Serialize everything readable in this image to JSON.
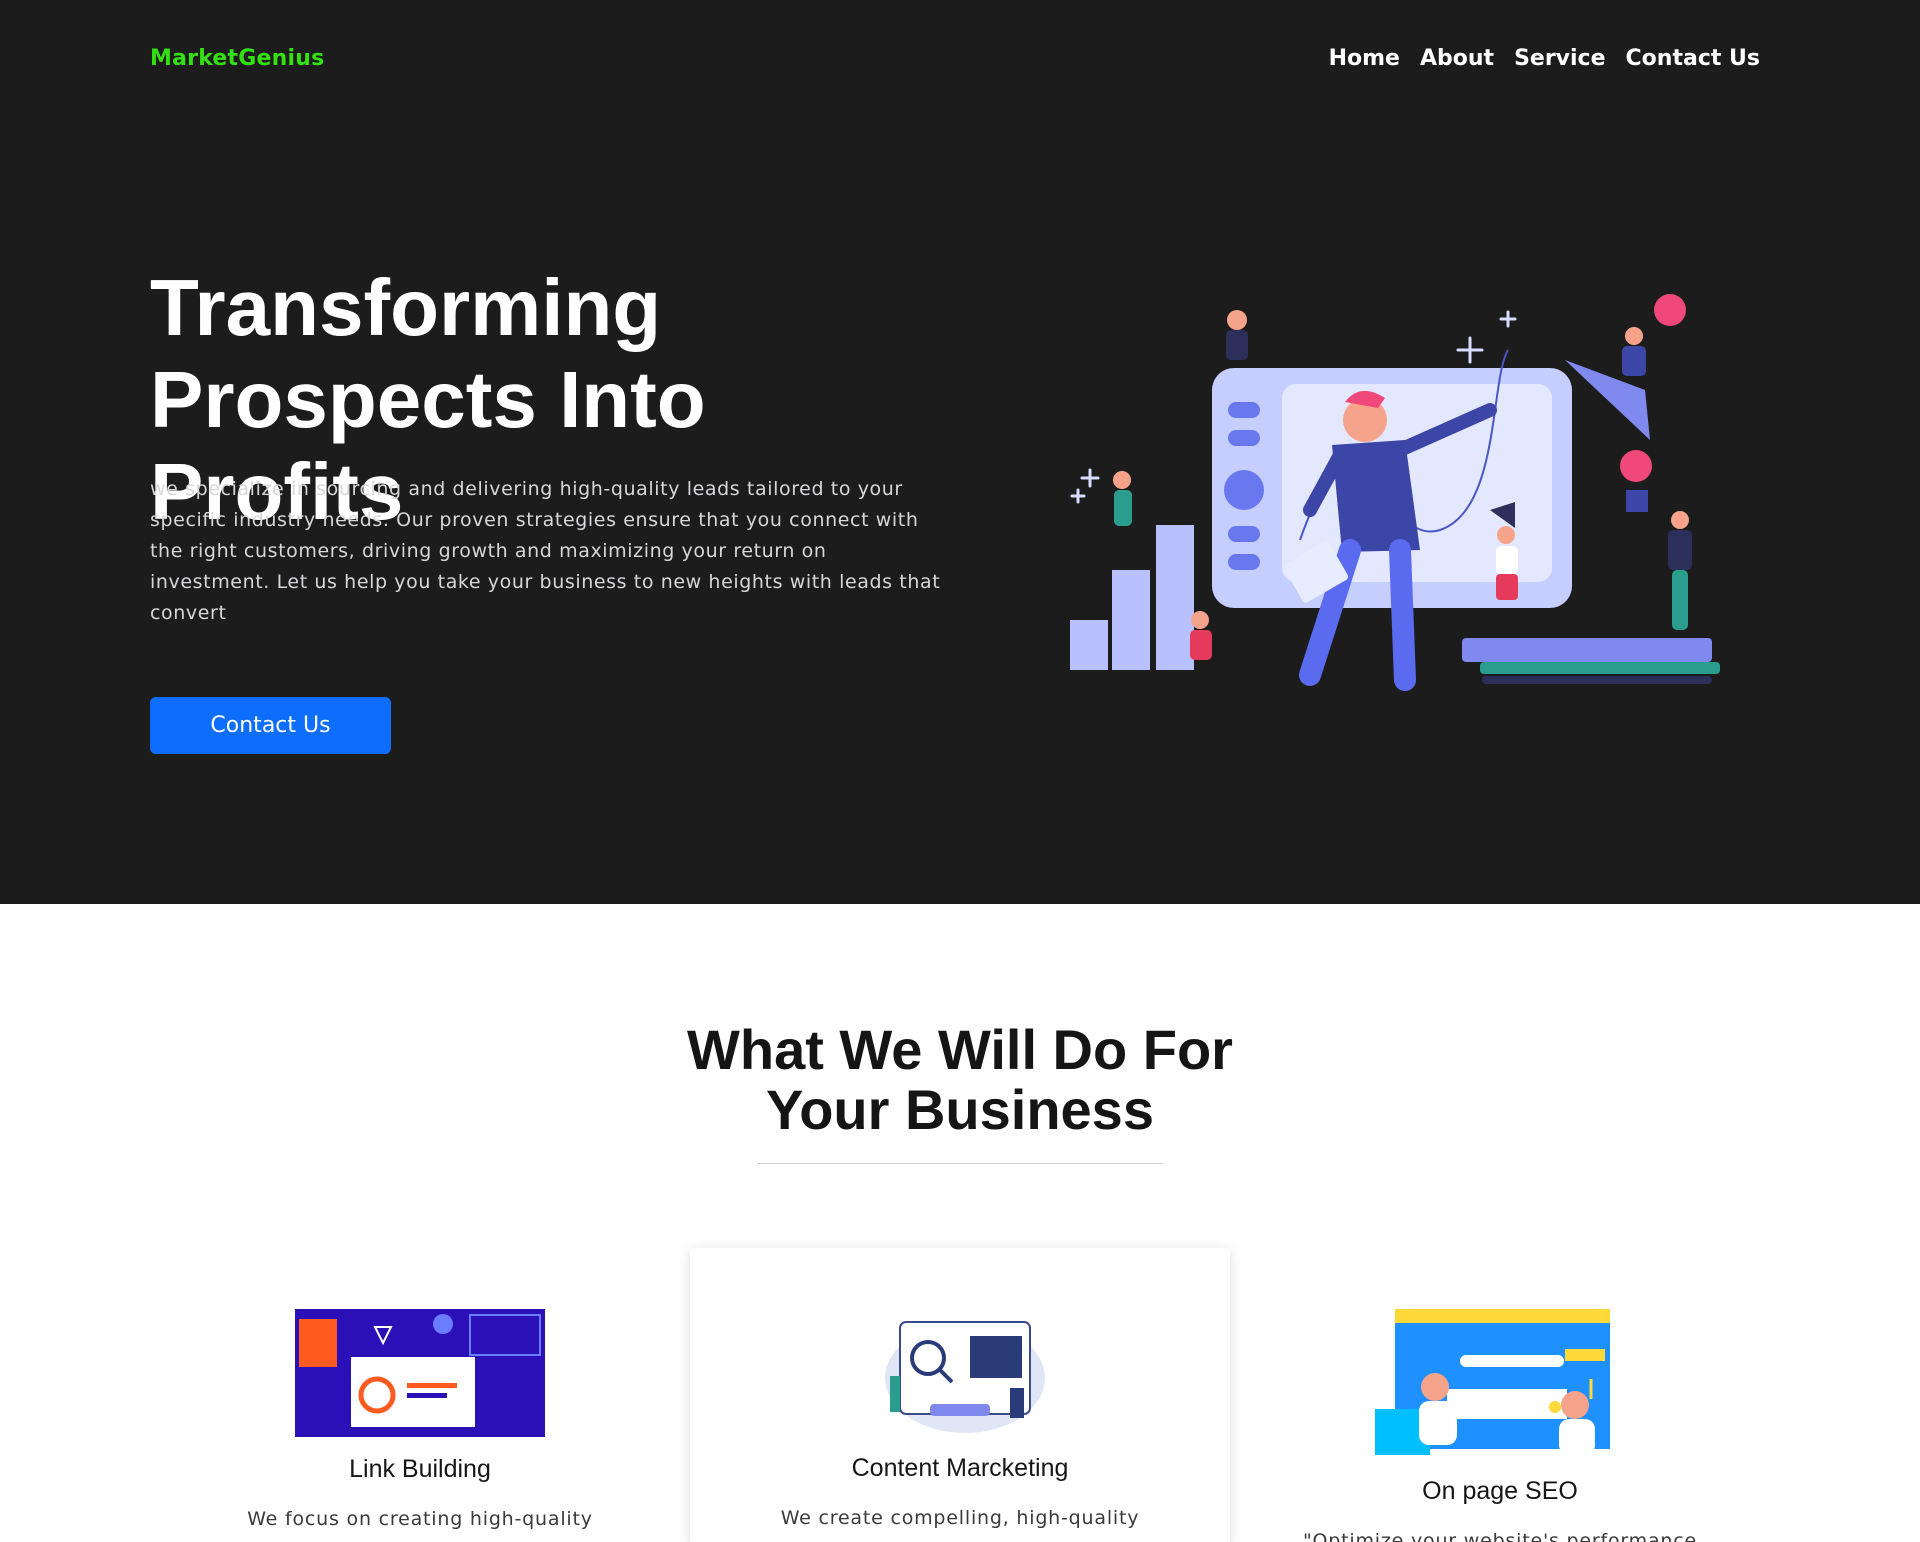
{
  "header": {
    "brand": "MarketGenius",
    "nav": [
      {
        "label": "Home"
      },
      {
        "label": "About"
      },
      {
        "label": "Service"
      },
      {
        "label": "Contact Us"
      }
    ]
  },
  "hero": {
    "title_line1": "Transforming",
    "title_line2": "Prospects Into Profits",
    "description": "we specialize in sourcing and delivering high-quality leads tailored to your specific industry needs. Our proven strategies ensure that you connect with the right customers, driving growth and maximizing your return on investment. Let us help you take your business to new heights with leads that convert",
    "cta_label": "Contact Us"
  },
  "services": {
    "title_line1": "What We Will Do For",
    "title_line2": "Your Business",
    "cards": [
      {
        "title": "Link Building",
        "text": "We focus on creating high-quality"
      },
      {
        "title": "Content Marcketing",
        "text": "We create compelling, high-quality"
      },
      {
        "title": "On page SEO",
        "text": "\"Optimize your website's performance"
      }
    ]
  },
  "colors": {
    "hero_bg": "#1c1c1d",
    "brand": "#33e012",
    "button": "#0d6efd"
  }
}
